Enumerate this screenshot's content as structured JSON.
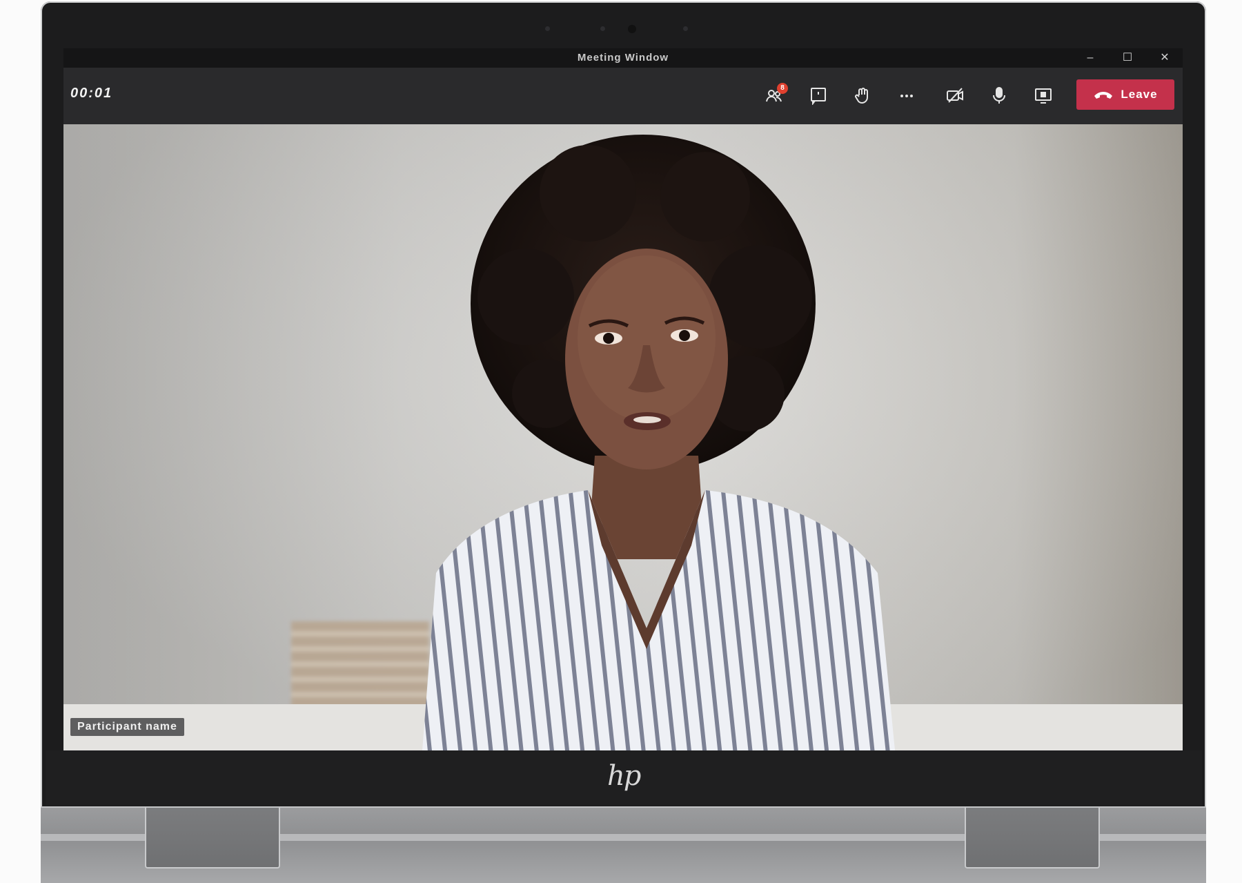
{
  "window": {
    "title": "Meeting Window",
    "controls": {
      "minimize": "–",
      "maximize": "☐",
      "close": "✕"
    }
  },
  "toolbar": {
    "timer": "00:01",
    "participants_badge": "8",
    "leave_label": "Leave",
    "icons": [
      "participants-icon",
      "chat-icon",
      "raise-hand-icon",
      "more-options-icon",
      "camera-icon",
      "microphone-icon",
      "share-screen-icon",
      "hang-up-icon"
    ]
  },
  "video": {
    "participant_name": "Participant name"
  },
  "device": {
    "brand_logo": "hp"
  },
  "colors": {
    "leave_button": "#c4314b",
    "toolbar": "#2a2a2c",
    "badge": "#e0402f"
  }
}
